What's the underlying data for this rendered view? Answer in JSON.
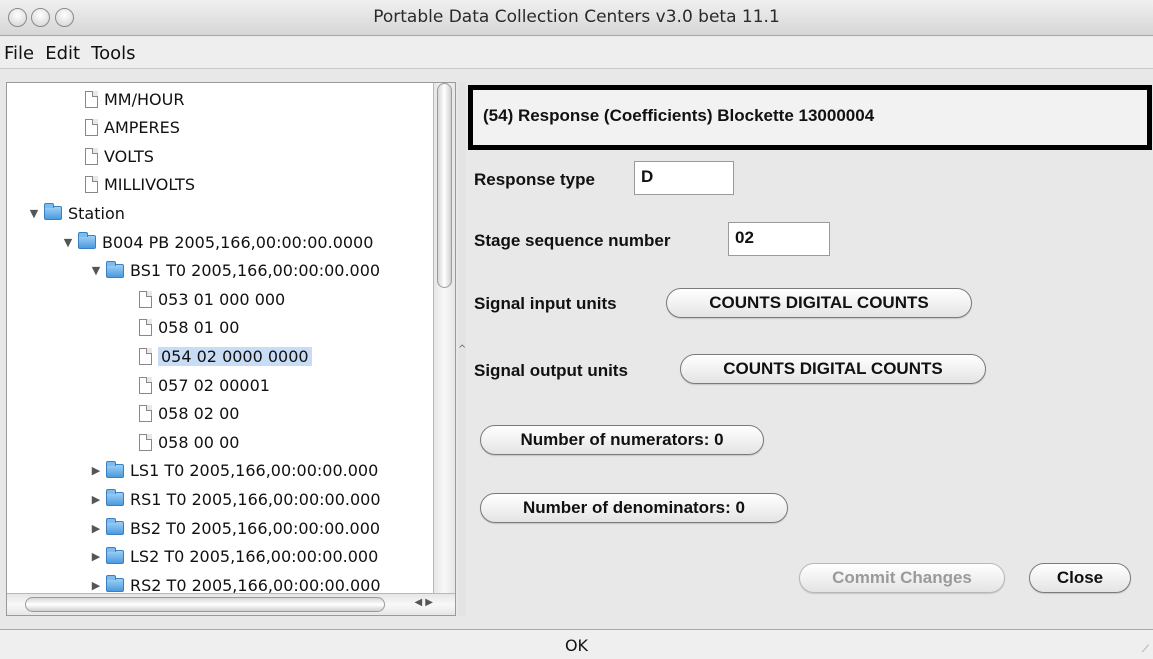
{
  "window": {
    "title": "Portable Data Collection Centers v3.0 beta 11.1"
  },
  "menu": [
    "File",
    "Edit",
    "Tools"
  ],
  "tree": {
    "rows": [
      {
        "label": "MM/HOUR",
        "type": "doc",
        "arrow": ""
      },
      {
        "label": "AMPERES",
        "type": "doc",
        "arrow": ""
      },
      {
        "label": "VOLTS",
        "type": "doc",
        "arrow": ""
      },
      {
        "label": "MILLIVOLTS",
        "type": "doc",
        "arrow": ""
      },
      {
        "label": "Station",
        "type": "folder",
        "arrow": "▼"
      },
      {
        "label": "B004 PB 2005,166,00:00:00.0000",
        "type": "folder",
        "arrow": "▼"
      },
      {
        "label": "BS1 T0 2005,166,00:00:00.000",
        "type": "folder",
        "arrow": "▼"
      },
      {
        "label": "053 01 000 000",
        "type": "doc",
        "arrow": ""
      },
      {
        "label": "058 01 00",
        "type": "doc",
        "arrow": ""
      },
      {
        "label": "054 02 0000 0000",
        "type": "doc",
        "arrow": "",
        "selected": true
      },
      {
        "label": "057 02 00001",
        "type": "doc",
        "arrow": ""
      },
      {
        "label": "058 02 00",
        "type": "doc",
        "arrow": ""
      },
      {
        "label": "058 00 00",
        "type": "doc",
        "arrow": ""
      },
      {
        "label": "LS1 T0 2005,166,00:00:00.000",
        "type": "folder",
        "arrow": "▶"
      },
      {
        "label": "RS1 T0 2005,166,00:00:00.000",
        "type": "folder",
        "arrow": "▶"
      },
      {
        "label": "BS2 T0 2005,166,00:00:00.000",
        "type": "folder",
        "arrow": "▶"
      },
      {
        "label": "LS2 T0 2005,166,00:00:00.000",
        "type": "folder",
        "arrow": "▶"
      },
      {
        "label": "RS2 T0 2005,166,00:00:00.000",
        "type": "folder",
        "arrow": "▶"
      }
    ]
  },
  "form": {
    "header": "(54) Response (Coefficients) Blockette 13000004",
    "response_type_label": "Response type",
    "response_type_value": "D",
    "stage_label": "Stage sequence number",
    "stage_value": "02",
    "input_units_label": "Signal input units",
    "input_units_value": "COUNTS DIGITAL COUNTS",
    "output_units_label": "Signal output units",
    "output_units_value": "COUNTS DIGITAL COUNTS",
    "numerators_label": "Number of numerators: 0",
    "denominators_label": "Number of denominators: 0",
    "commit_label": "Commit Changes",
    "close_label": "Close"
  },
  "status": {
    "text": "OK"
  }
}
